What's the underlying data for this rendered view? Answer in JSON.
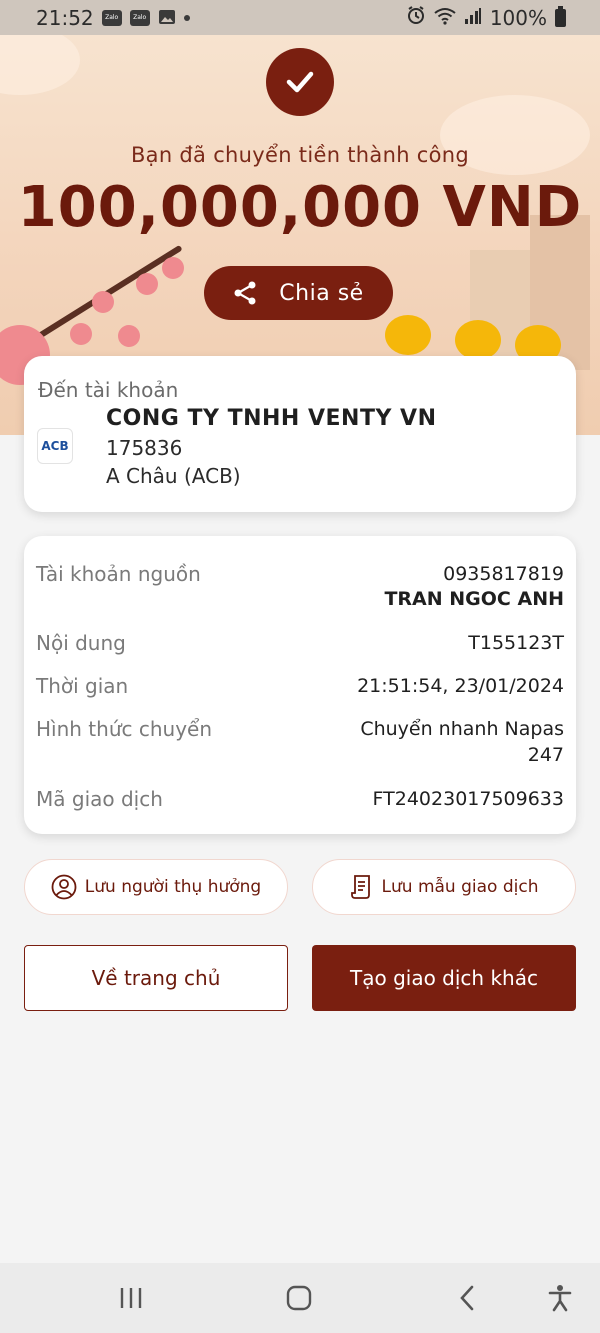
{
  "status_bar": {
    "time": "21:52",
    "app_icons": [
      "Zalo",
      "Zalo"
    ],
    "battery": "100%"
  },
  "header": {
    "success_text": "Bạn đã chuyển tiền thành công",
    "amount": "100,000,000 VND",
    "share_label": "Chia sẻ"
  },
  "destination": {
    "label": "Đến tài khoản",
    "bank_logo_text": "ACB",
    "name": "CONG TY TNHH VENTY VN",
    "account": "175836",
    "bank": "A Châu (ACB)"
  },
  "details": {
    "source_label": "Tài khoản nguồn",
    "source_account": "0935817819",
    "source_name": "TRAN NGOC ANH",
    "content_label": "Nội dung",
    "content_value": "T155123T",
    "time_label": "Thời gian",
    "time_value": "21:51:54, 23/01/2024",
    "method_label": "Hình thức chuyển",
    "method_value_line1": "Chuyển nhanh Napas",
    "method_value_line2": "247",
    "txn_label": "Mã giao dịch",
    "txn_value": "FT24023017509633"
  },
  "actions": {
    "save_beneficiary": "Lưu người thụ hưởng",
    "save_template": "Lưu mẫu giao dịch",
    "home": "Về trang chủ",
    "new_transaction": "Tạo giao dịch khác"
  },
  "colors": {
    "primary": "#7a1f10",
    "hero_bg": "#f3d4bb",
    "page_bg": "#f4f4f4"
  },
  "icons": {
    "success": "check-icon",
    "share": "share-icon",
    "beneficiary": "user-circle-icon",
    "template": "receipt-icon",
    "nav_recent": "recent-apps-icon",
    "nav_home": "home-icon",
    "nav_back": "back-icon",
    "nav_accessibility": "accessibility-icon"
  }
}
